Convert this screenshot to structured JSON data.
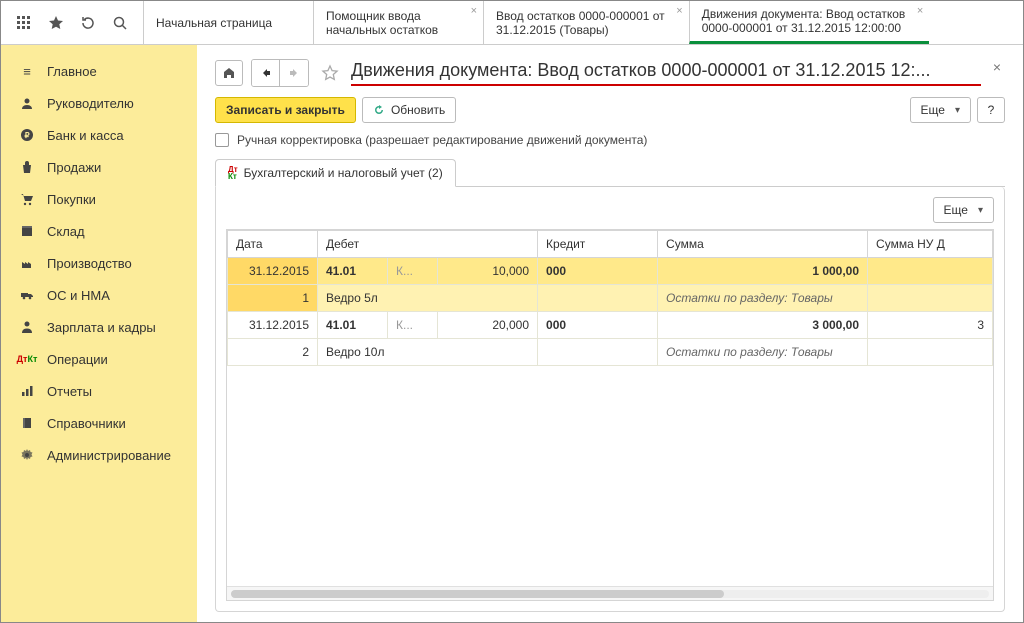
{
  "topbar_tabs": [
    {
      "line1": "Начальная страница",
      "line2": ""
    },
    {
      "line1": "Помощник ввода",
      "line2": "начальных остатков"
    },
    {
      "line1": "Ввод остатков 0000-000001 от",
      "line2": "31.12.2015 (Товары)"
    },
    {
      "line1": "Движения документа: Ввод остатков",
      "line2": "0000-000001 от 31.12.2015 12:00:00"
    }
  ],
  "sidebar": [
    {
      "label": "Главное"
    },
    {
      "label": "Руководителю"
    },
    {
      "label": "Банк и касса"
    },
    {
      "label": "Продажи"
    },
    {
      "label": "Покупки"
    },
    {
      "label": "Склад"
    },
    {
      "label": "Производство"
    },
    {
      "label": "ОС и НМА"
    },
    {
      "label": "Зарплата и кадры"
    },
    {
      "label": "Операции"
    },
    {
      "label": "Отчеты"
    },
    {
      "label": "Справочники"
    },
    {
      "label": "Администрирование"
    }
  ],
  "page_title": "Движения документа: Ввод остатков 0000-000001 от 31.12.2015 12:...",
  "buttons": {
    "save_close": "Записать и закрыть",
    "refresh": "Обновить",
    "more": "Еще",
    "help": "?"
  },
  "manual_edit_label": "Ручная корректировка (разрешает редактирование движений документа)",
  "register_tab": "Бухгалтерский и налоговый учет (2)",
  "grid": {
    "headers": {
      "date": "Дата",
      "debit": "Дебет",
      "credit": "Кредит",
      "sum": "Сумма",
      "sum_nu": "Сумма НУ Д"
    },
    "rows": [
      {
        "selected": true,
        "line1": {
          "date": "31.12.2015",
          "account_d": "41.01",
          "k": "К...",
          "qty": "10,000",
          "account_c": "000",
          "sum": "1 000,00",
          "sum_nu": ""
        },
        "line2": {
          "num": "1",
          "item": "Ведро 5л",
          "comment": "Остатки по разделу: Товары"
        }
      },
      {
        "selected": false,
        "line1": {
          "date": "31.12.2015",
          "account_d": "41.01",
          "k": "К...",
          "qty": "20,000",
          "account_c": "000",
          "sum": "3 000,00",
          "sum_nu": "3"
        },
        "line2": {
          "num": "2",
          "item": "Ведро 10л",
          "comment": "Остатки по разделу: Товары"
        }
      }
    ]
  }
}
